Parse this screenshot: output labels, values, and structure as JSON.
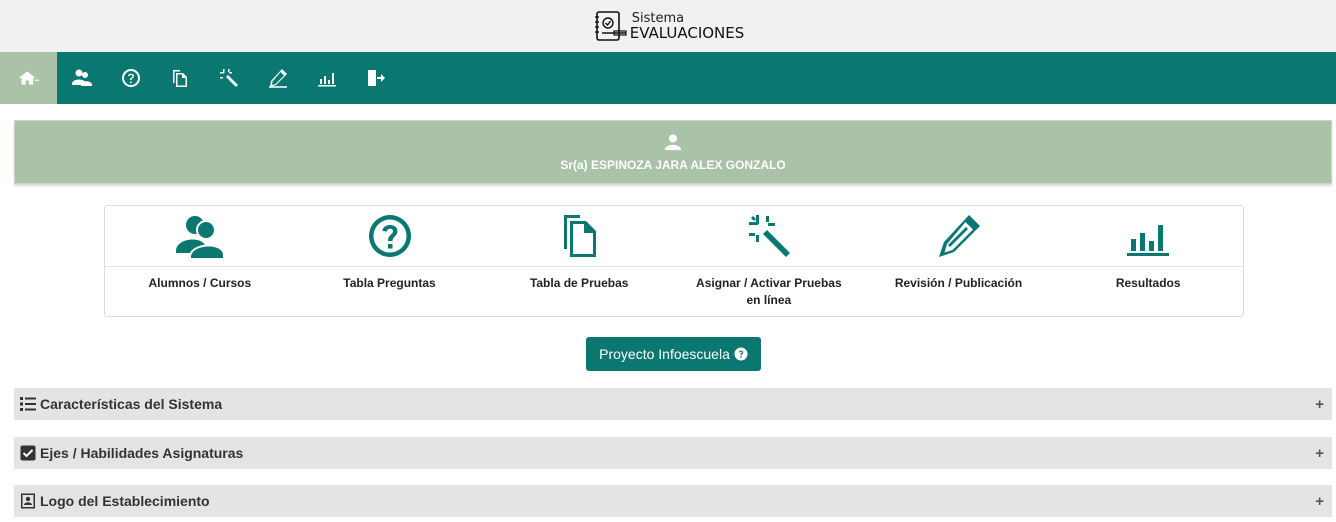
{
  "header": {
    "brand_small": "Sistema",
    "brand_main": "EVALUACIONES"
  },
  "nav": {
    "items": [
      {
        "icon": "home-icon"
      },
      {
        "icon": "users-icon"
      },
      {
        "icon": "question-icon"
      },
      {
        "icon": "copy-icon"
      },
      {
        "icon": "magic-wand-icon"
      },
      {
        "icon": "pencil-icon"
      },
      {
        "icon": "bar-chart-icon"
      },
      {
        "icon": "logout-icon"
      }
    ],
    "active_index": 0
  },
  "user": {
    "name": "Sr(a) ESPINOZA JARA ALEX GONZALO"
  },
  "modules": [
    {
      "label": "Alumnos / Cursos"
    },
    {
      "label": "Tabla Preguntas"
    },
    {
      "label": "Tabla de Pruebas"
    },
    {
      "label": "Asignar / Activar Pruebas en línea"
    },
    {
      "label": "Revisión / Publicación"
    },
    {
      "label": "Resultados"
    }
  ],
  "project_button": {
    "label": "Proyecto Infoescuela"
  },
  "accordions": [
    {
      "title": "Características del Sistema",
      "toggle": "+"
    },
    {
      "title": "Ejes / Habilidades Asignaturas",
      "toggle": "+"
    },
    {
      "title": "Logo del Establecimiento",
      "toggle": "+"
    }
  ],
  "colors": {
    "primary": "#0a7770",
    "banner": "#a9c2a8",
    "header_bg": "#f1f1f1",
    "accordion_bg": "#e5e4e2"
  }
}
